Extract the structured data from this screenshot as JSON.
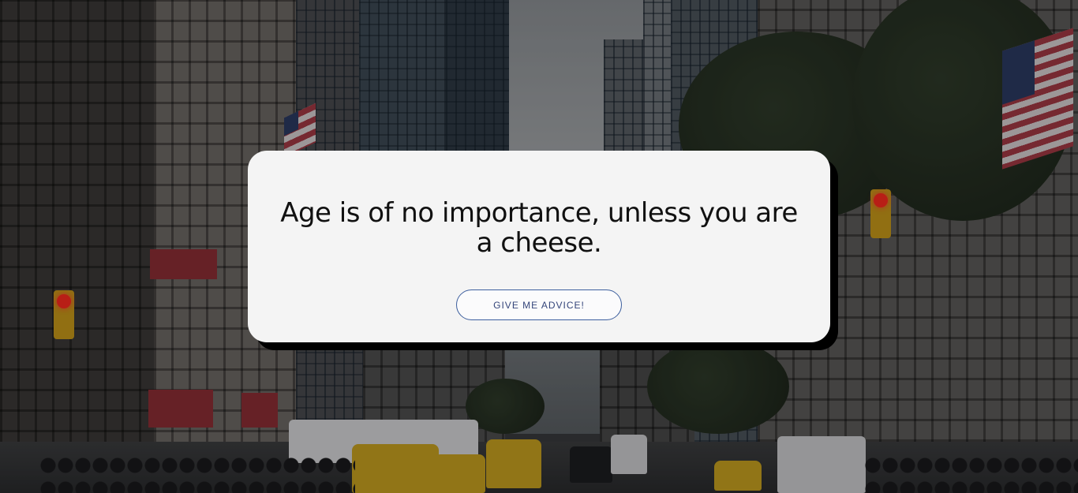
{
  "quote": {
    "text": "Age is of no importance, unless you are a cheese."
  },
  "advice_button": {
    "label": "GIVE ME ADVICE!"
  },
  "background": {
    "description_icon": "city-street-photo",
    "accent_colors": {
      "card": "#f4f4f4",
      "button_border": "#3d5f9e",
      "button_text": "#34457a",
      "shadow": "#000000"
    }
  }
}
